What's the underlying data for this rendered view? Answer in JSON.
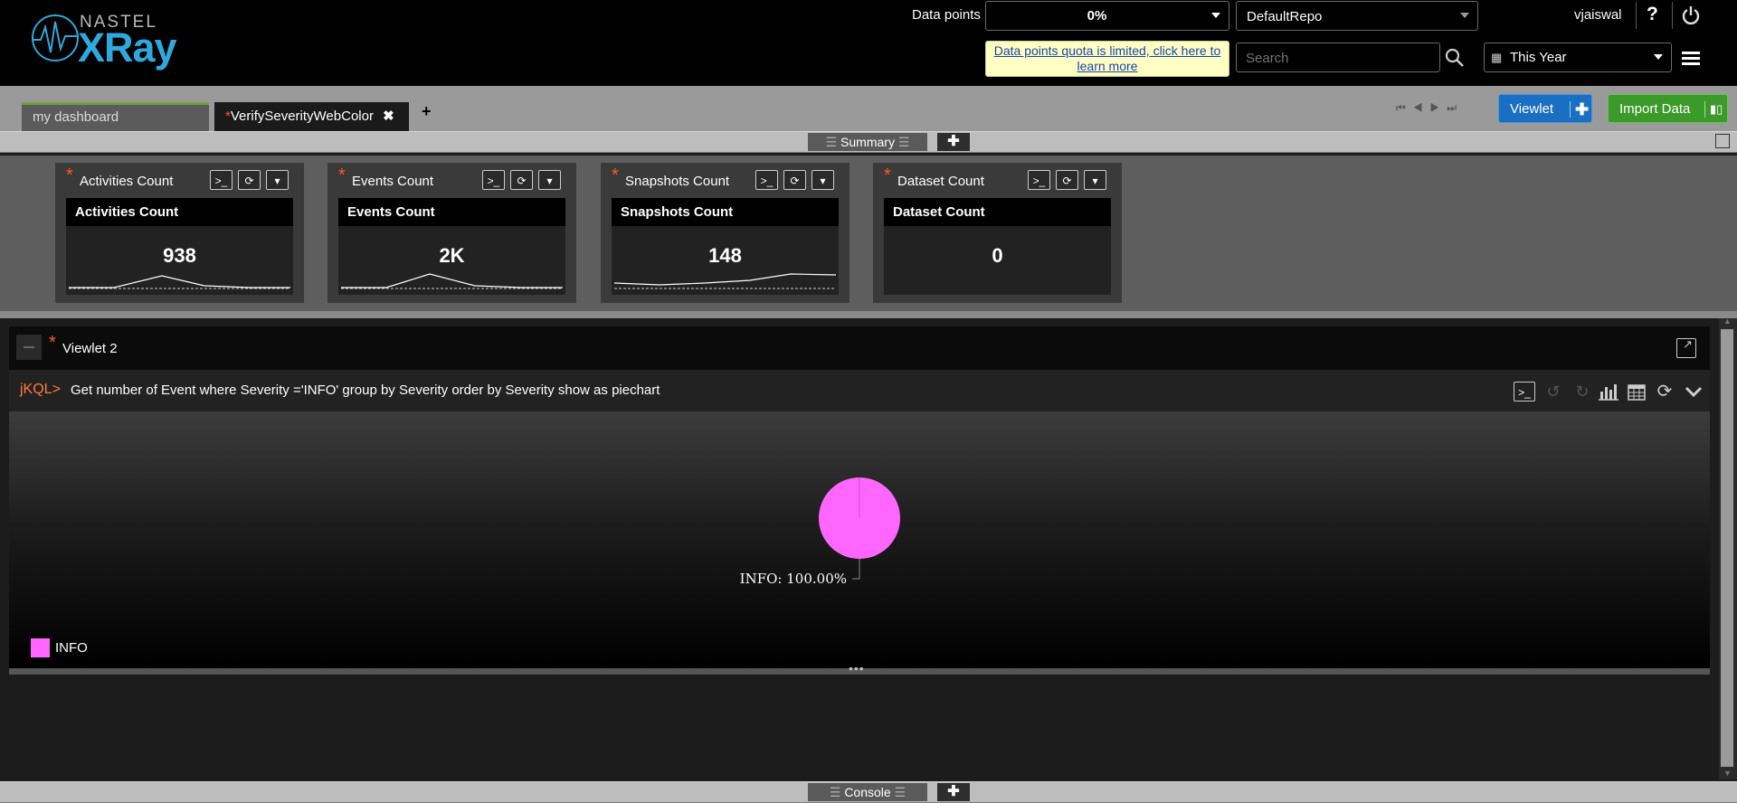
{
  "app": {
    "brand_top": "NASTEL",
    "brand_main": "XRay"
  },
  "header": {
    "datapoints_label": "Data points",
    "datapoints_value": "0%",
    "repo": "DefaultRepo",
    "user": "vjaiswal",
    "quota_message": "Data points quota is limited, click here to learn more",
    "search_placeholder": "Search",
    "timeframe": "This Year"
  },
  "tabs": [
    {
      "label": "my dashboard"
    },
    {
      "label": "VerifySeverityWebColor",
      "modified_marker": "*"
    }
  ],
  "toolbar": {
    "viewlet_label": "Viewlet",
    "import_label": "Import Data"
  },
  "summary_strip": {
    "label": "Summary"
  },
  "cards": [
    {
      "title": "Activities Count",
      "inner_title": "Activities Count",
      "value": "938"
    },
    {
      "title": "Events Count",
      "inner_title": "Events Count",
      "value": "2K"
    },
    {
      "title": "Snapshots Count",
      "inner_title": "Snapshots Count",
      "value": "148"
    },
    {
      "title": "Dataset Count",
      "inner_title": "Dataset Count",
      "value": "0"
    }
  ],
  "viewlet": {
    "title": "Viewlet 2",
    "jkql_prompt": "jKQL>",
    "query": "Get number of Event where Severity ='INFO' group by Severity order by Severity show as piechart"
  },
  "chart_data": {
    "type": "pie",
    "categories": [
      "INFO"
    ],
    "values": [
      100
    ],
    "labels": [
      "INFO: 100.00%"
    ],
    "colors": [
      "#ff66ff"
    ],
    "legend": "bottom-left"
  },
  "console_strip": {
    "label": "Console"
  },
  "colors": {
    "header_bg": "#000000",
    "accent_blue": "#1a6fc2",
    "accent_green": "#3c9a2a",
    "marker_orange": "#ff5a1f",
    "pie_magenta": "#ff66ff"
  }
}
